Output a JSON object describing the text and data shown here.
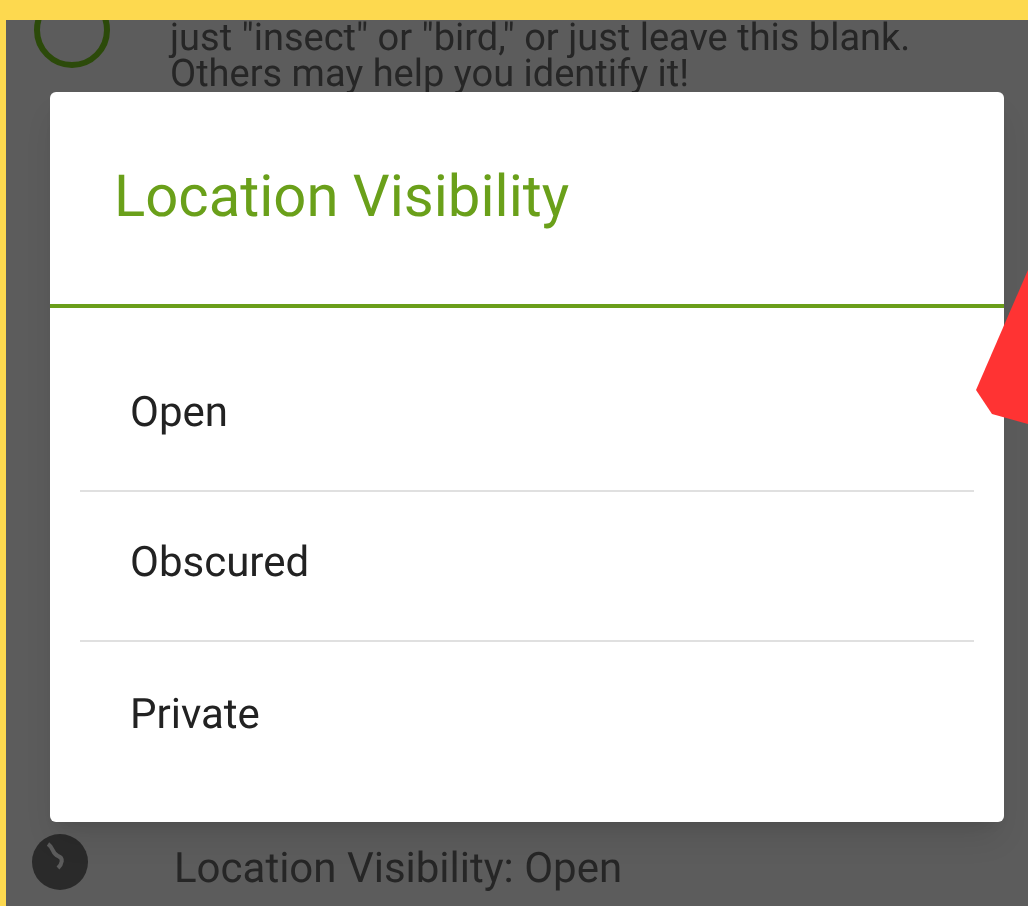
{
  "background": {
    "hint_lines": [
      "just \"insect\" or \"bird,\" or just leave this blank.",
      "Others may help you identify it!"
    ],
    "location_row": "Location Visibility: Open"
  },
  "dialog": {
    "title": "Location Visibility",
    "options": [
      "Open",
      "Obscured",
      "Private"
    ]
  }
}
